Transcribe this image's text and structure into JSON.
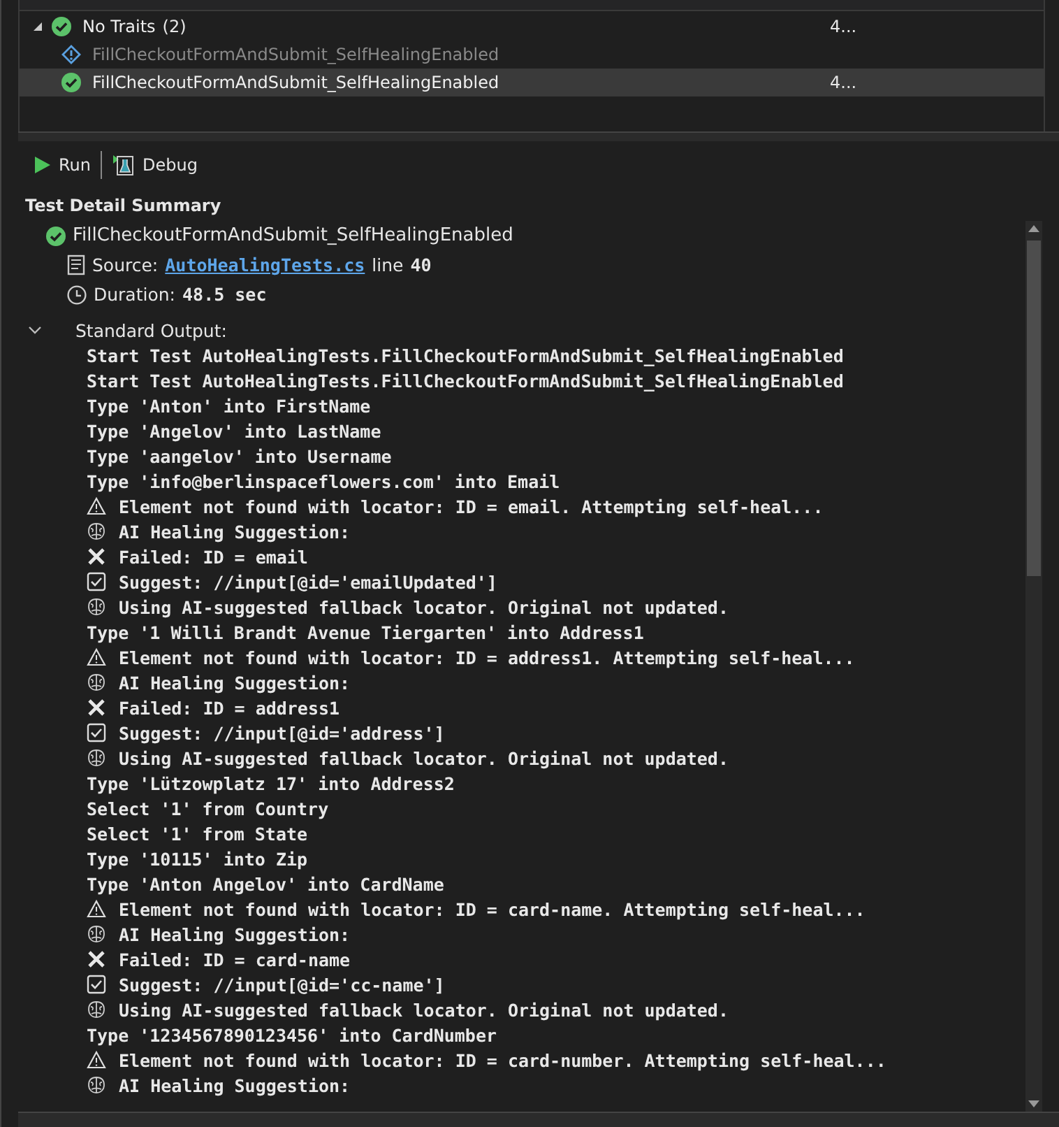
{
  "test_list": {
    "group": {
      "label": "No Traits",
      "count": "(2)",
      "kind": "passed",
      "expanded": true,
      "duration": "4..."
    },
    "items": [
      {
        "name": "FillCheckoutFormAndSubmit_SelfHealingEnabled",
        "kind": "warning",
        "selected": false,
        "disabled": true
      },
      {
        "name": "FillCheckoutFormAndSubmit_SelfHealingEnabled",
        "kind": "passed",
        "selected": true,
        "disabled": false,
        "duration": "4..."
      }
    ]
  },
  "toolbar": {
    "run": "Run",
    "debug": "Debug"
  },
  "summary": {
    "title": "Test Detail Summary",
    "test_name": "FillCheckoutFormAndSubmit_SelfHealingEnabled",
    "kind": "passed",
    "source_label": "Source:",
    "source_link": "AutoHealingTests.cs",
    "line_label": "line",
    "line_number": "40",
    "duration_label": "Duration:",
    "duration": "48.5 sec",
    "output_label": "Standard Output:",
    "output_expanded": true,
    "output": [
      {
        "kind": "plain",
        "text": "Start Test AutoHealingTests.FillCheckoutFormAndSubmit_SelfHealingEnabled"
      },
      {
        "kind": "plain",
        "text": "Start Test AutoHealingTests.FillCheckoutFormAndSubmit_SelfHealingEnabled"
      },
      {
        "kind": "plain",
        "text": "Type 'Anton' into FirstName"
      },
      {
        "kind": "plain",
        "text": "Type 'Angelov' into LastName"
      },
      {
        "kind": "plain",
        "text": "Type 'aangelov' into Username"
      },
      {
        "kind": "plain",
        "text": "Type 'info@berlinspaceflowers.com' into Email"
      },
      {
        "kind": "warning",
        "text": "Element not found with locator: ID = email. Attempting self-heal..."
      },
      {
        "kind": "brain",
        "text": "AI Healing Suggestion:"
      },
      {
        "kind": "failed",
        "text": "Failed: ID = email"
      },
      {
        "kind": "suggest",
        "text": "Suggest: //input[@id='emailUpdated']"
      },
      {
        "kind": "brain",
        "text": "Using AI-suggested fallback locator. Original not updated."
      },
      {
        "kind": "plain",
        "text": "Type '1 Willi Brandt Avenue Tiergarten' into Address1"
      },
      {
        "kind": "warning",
        "text": "Element not found with locator: ID = address1. Attempting self-heal..."
      },
      {
        "kind": "brain",
        "text": "AI Healing Suggestion:"
      },
      {
        "kind": "failed",
        "text": "Failed: ID = address1"
      },
      {
        "kind": "suggest",
        "text": "Suggest: //input[@id='address']"
      },
      {
        "kind": "brain",
        "text": "Using AI-suggested fallback locator. Original not updated."
      },
      {
        "kind": "plain",
        "text": "Type 'Lützowplatz 17' into Address2"
      },
      {
        "kind": "plain",
        "text": "Select '1' from Country"
      },
      {
        "kind": "plain",
        "text": "Select '1' from State"
      },
      {
        "kind": "plain",
        "text": "Type '10115' into Zip"
      },
      {
        "kind": "plain",
        "text": "Type 'Anton Angelov' into CardName"
      },
      {
        "kind": "warning",
        "text": "Element not found with locator: ID = card-name. Attempting self-heal..."
      },
      {
        "kind": "brain",
        "text": "AI Healing Suggestion:"
      },
      {
        "kind": "failed",
        "text": "Failed: ID = card-name"
      },
      {
        "kind": "suggest",
        "text": "Suggest: //input[@id='cc-name']"
      },
      {
        "kind": "brain",
        "text": "Using AI-suggested fallback locator. Original not updated."
      },
      {
        "kind": "plain",
        "text": "Type '1234567890123456' into CardNumber"
      },
      {
        "kind": "warning",
        "text": "Element not found with locator: ID = card-number. Attempting self-heal..."
      },
      {
        "kind": "brain",
        "text": "AI Healing Suggestion:"
      }
    ]
  }
}
